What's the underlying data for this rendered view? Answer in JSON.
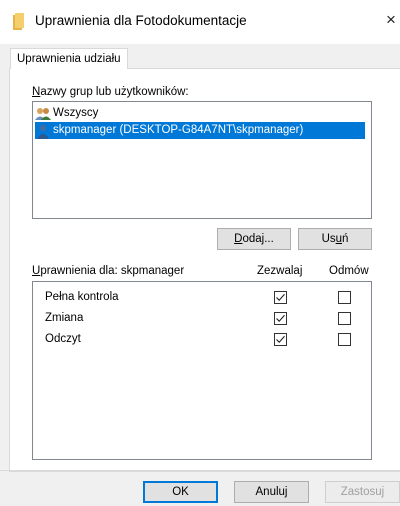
{
  "window": {
    "title": "Uprawnienia dla Fotodokumentacje",
    "close_glyph": "×"
  },
  "tab": {
    "label": "Uprawnienia udziału"
  },
  "groups": {
    "label_prefix": "N",
    "label_rest": "azwy grup lub użytkowników:",
    "items": [
      {
        "name": "Wszyscy",
        "icon": "group-users-icon",
        "selected": false
      },
      {
        "name": "skpmanager (DESKTOP-G84A7NT\\skpmanager)",
        "icon": "user-icon",
        "selected": true
      }
    ],
    "add_button": {
      "underlined": "D",
      "rest": "odaj..."
    },
    "remove_button": {
      "before": "Us",
      "underlined": "u",
      "after": "ń"
    }
  },
  "permissions": {
    "label_prefix": "U",
    "label_rest": "prawnienia dla: skpmanager",
    "allow_header": "Zezwalaj",
    "deny_header": "Odmów",
    "rows": [
      {
        "name": "Pełna kontrola",
        "allow": true,
        "deny": false
      },
      {
        "name": "Zmiana",
        "allow": true,
        "deny": false
      },
      {
        "name": "Odczyt",
        "allow": true,
        "deny": false
      }
    ]
  },
  "footer": {
    "ok_label": "OK",
    "cancel_label": "Anuluj",
    "apply_label": "Zastosuj"
  },
  "colors": {
    "selection": "#0078d7",
    "folder_icon": "#e8b44a",
    "dialog_bg": "#f0f0f0"
  }
}
